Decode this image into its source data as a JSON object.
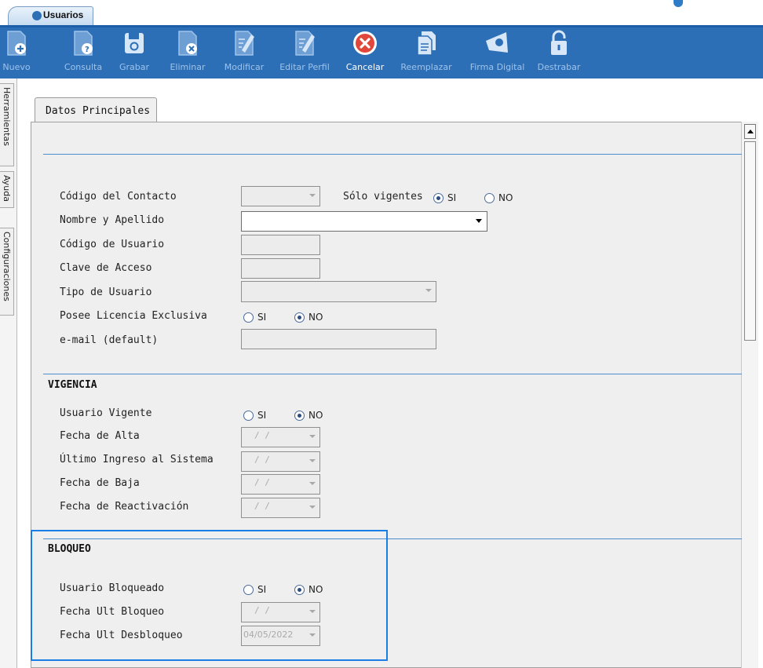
{
  "window": {
    "tab_title": "Usuarios"
  },
  "toolbar": {
    "items": [
      {
        "label": "Nuevo",
        "icon": "new-doc-icon",
        "active": false
      },
      {
        "label": "Consulta",
        "icon": "query-doc-icon",
        "active": false
      },
      {
        "label": "Grabar",
        "icon": "save-icon",
        "active": false
      },
      {
        "label": "Eliminar",
        "icon": "delete-doc-icon",
        "active": false
      },
      {
        "label": "Modificar",
        "icon": "edit-doc-icon",
        "active": false
      },
      {
        "label": "Editar Perfil",
        "icon": "edit-profile-icon",
        "active": false
      },
      {
        "label": "Cancelar",
        "icon": "cancel-icon",
        "active": true
      },
      {
        "label": "Reemplazar",
        "icon": "replace-doc-icon",
        "active": false
      },
      {
        "label": "Firma Digital",
        "icon": "digital-signature-icon",
        "active": false
      },
      {
        "label": "Destrabar",
        "icon": "unlock-icon",
        "active": false
      }
    ]
  },
  "side_tabs": [
    "Herramientas",
    "Ayuda",
    "Configuraciones"
  ],
  "form": {
    "tab_label": "Datos Principales",
    "main": {
      "codigo_contacto": "Código del Contacto",
      "solo_vigentes": "Sólo vigentes",
      "nombre_apellido": "Nombre y Apellido",
      "codigo_usuario": "Código de Usuario",
      "clave_acceso": "Clave de Acceso",
      "tipo_usuario": "Tipo de Usuario",
      "licencia_exclusiva": "Posee Licencia Exclusiva",
      "email": "e-mail (default)"
    },
    "vigencia": {
      "title": "VIGENCIA",
      "usuario_vigente": "Usuario Vigente",
      "fecha_alta": "Fecha de Alta",
      "ultimo_ingreso": "Último Ingreso al Sistema",
      "fecha_baja": "Fecha de Baja",
      "fecha_reactivacion": "Fecha de Reactivación"
    },
    "bloqueo": {
      "title": "BLOQUEO",
      "usuario_bloqueado": "Usuario Bloqueado",
      "fecha_ult_bloqueo": "Fecha Ult Bloqueo",
      "fecha_ult_desbloqueo": "Fecha Ult Desbloqueo",
      "fecha_ult_desbloqueo_value": "04/05/2022"
    },
    "radio_si": "SI",
    "radio_no": "NO",
    "empty_date": "/ /"
  },
  "colors": {
    "toolbar_bg": "#2d6fb6",
    "accent": "#1a7ee6",
    "cancel_red": "#e0463a"
  }
}
